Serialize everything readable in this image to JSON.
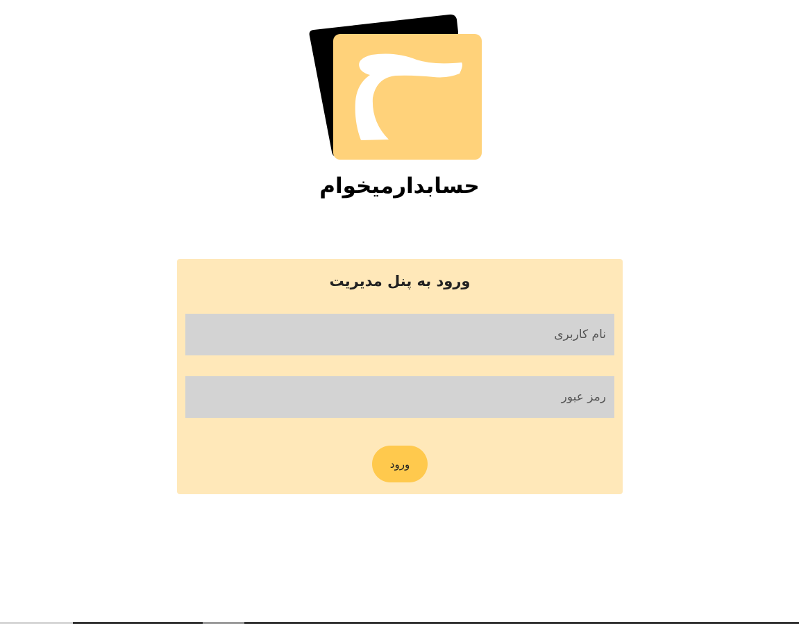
{
  "brand": {
    "name": "حسابدارمیخوام",
    "logo_letter": "ح",
    "colors": {
      "logo_front": "#ffd27a",
      "logo_back": "#000000",
      "logo_letter": "#ffffff"
    }
  },
  "login": {
    "title": "ورود به پنل مدیریت",
    "username_placeholder": "نام کاربری",
    "password_placeholder": "رمز عبور",
    "submit_label": "ورود",
    "colors": {
      "card_bg": "#ffe8b9",
      "field_bg": "#d3d3d3",
      "button_bg": "#ffc94d"
    }
  }
}
